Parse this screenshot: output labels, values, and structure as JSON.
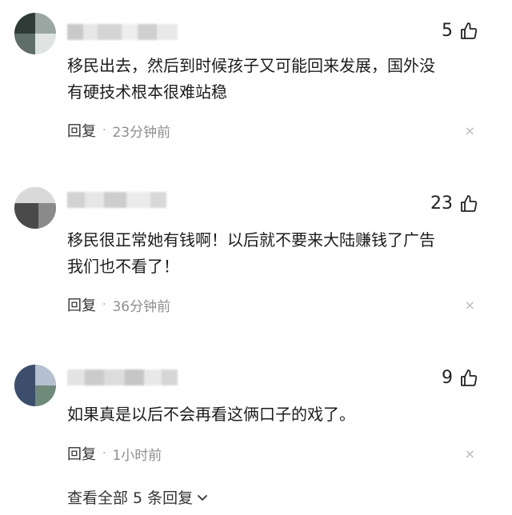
{
  "comments": [
    {
      "likes": "5",
      "text": "移民出去，然后到时候孩子又可能回来发展，国外没\n有硬技术根本很难站稳",
      "reply_label": "回复",
      "separator": "·",
      "time": "23分钟前",
      "close_glyph": "×"
    },
    {
      "likes": "23",
      "text": "移民很正常她有钱啊！以后就不要来大陆赚钱了广告\n我们也不看了！",
      "reply_label": "回复",
      "separator": "·",
      "time": "36分钟前",
      "close_glyph": "×"
    },
    {
      "likes": "9",
      "text": "如果真是以后不会再看这俩口子的戏了。",
      "reply_label": "回复",
      "separator": "·",
      "time": "1小时前",
      "close_glyph": "×"
    }
  ],
  "view_all": {
    "label": "查看全部 5 条回复"
  },
  "icons": {
    "like": "thumbs-up-icon",
    "expand": "chevron-down-icon",
    "close": "close-icon"
  }
}
